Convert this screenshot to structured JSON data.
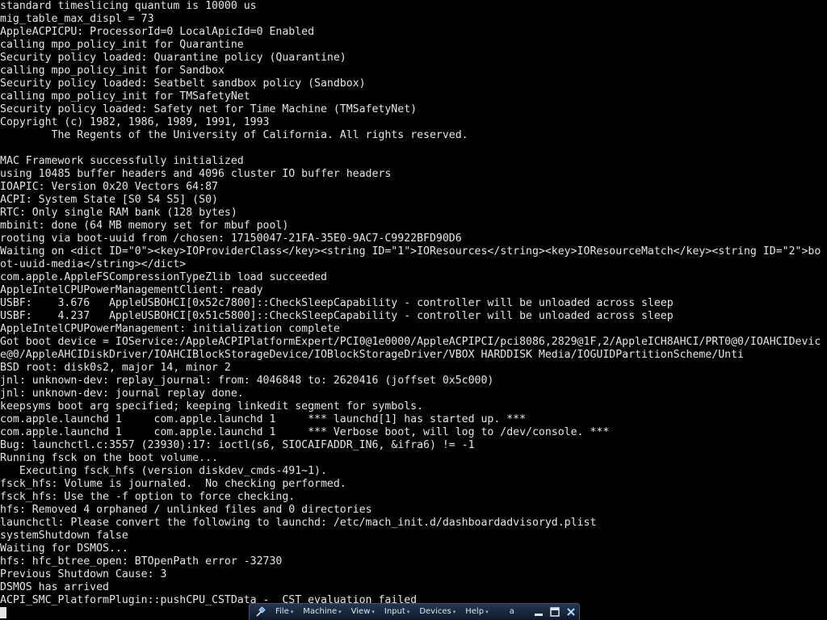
{
  "console": {
    "lines": [
      "standard timeslicing quantum is 10000 us",
      "mig_table_max_displ = 73",
      "AppleACPICPU: ProcessorId=0 LocalApicId=0 Enabled",
      "calling mpo_policy_init for Quarantine",
      "Security policy loaded: Quarantine policy (Quarantine)",
      "calling mpo_policy_init for Sandbox",
      "Security policy loaded: Seatbelt sandbox policy (Sandbox)",
      "calling mpo_policy_init for TMSafetyNet",
      "Security policy loaded: Safety net for Time Machine (TMSafetyNet)",
      "Copyright (c) 1982, 1986, 1989, 1991, 1993",
      "        The Regents of the University of California. All rights reserved.",
      "",
      "MAC Framework successfully initialized",
      "using 10485 buffer headers and 4096 cluster IO buffer headers",
      "IOAPIC: Version 0x20 Vectors 64:87",
      "ACPI: System State [S0 S4 S5] (S0)",
      "RTC: Only single RAM bank (128 bytes)",
      "mbinit: done (64 MB memory set for mbuf pool)",
      "rooting via boot-uuid from /chosen: 17150047-21FA-35E0-9AC7-C9922BFD90D6",
      "Waiting on <dict ID=\"0\"><key>IOProviderClass</key><string ID=\"1\">IOResources</string><key>IOResourceMatch</key><string ID=\"2\">bo",
      "ot-uuid-media</string></dict>",
      "com.apple.AppleFSCompressionTypeZlib load succeeded",
      "AppleIntelCPUPowerManagementClient: ready",
      "USBF:    3.676   AppleUSBOHCI[0x52c7800]::CheckSleepCapability - controller will be unloaded across sleep",
      "USBF:    4.237   AppleUSBOHCI[0x51c5800]::CheckSleepCapability - controller will be unloaded across sleep",
      "AppleIntelCPUPowerManagement: initialization complete",
      "Got boot device = IOService:/AppleACPIPlatformExpert/PCI0@1e0000/AppleACPIPCI/pci8086,2829@1F,2/AppleICH8AHCI/PRT0@0/IOAHCIDevic",
      "e@0/AppleAHCIDiskDriver/IOAHCIBlockStorageDevice/IOBlockStorageDriver/VBOX HARDDISK Media/IOGUIDPartitionScheme/Unti",
      "BSD root: disk0s2, major 14, minor 2",
      "jnl: unknown-dev: replay_journal: from: 4046848 to: 2620416 (joffset 0x5c000)",
      "jnl: unknown-dev: journal replay done.",
      "keepsyms boot arg specified; keeping linkedit segment for symbols.",
      "com.apple.launchd 1     com.apple.launchd 1     *** launchd[1] has started up. ***",
      "com.apple.launchd 1     com.apple.launchd 1     *** Verbose boot, will log to /dev/console. ***",
      "Bug: launchctl.c:3557 (23930):17: ioctl(s6, SIOCAIFADDR_IN6, &ifra6) != -1",
      "Running fsck on the boot volume...",
      "   Executing fsck_hfs (version diskdev_cmds-491~1).",
      "fsck_hfs: Volume is journaled.  No checking performed.",
      "fsck_hfs: Use the -f option to force checking.",
      "hfs: Removed 4 orphaned / unlinked files and 0 directories",
      "launchctl: Please convert the following to launchd: /etc/mach_init.d/dashboardadvisoryd.plist",
      "systemShutdown false",
      "Waiting for DSMOS...",
      "hfs: hfc_btree_open: BTOpenPath error -32730",
      "Previous Shutdown Cause: 3",
      "DSMOS has arrived",
      "ACPI_SMC_PlatformPlugin::pushCPU_CSTData - _CST evaluation failed"
    ]
  },
  "toolbar": {
    "menus": [
      "File",
      "Machine",
      "View",
      "Input",
      "Devices",
      "Help"
    ],
    "title": "a",
    "icons": [
      "pin-icon",
      "minimize-icon",
      "restore-icon",
      "close-icon"
    ],
    "colors": {
      "background": "#1b2a40",
      "text": "#dce6f5",
      "close": "#3a8ee6"
    }
  },
  "colors": {
    "console_background": "#000000",
    "console_text": "#e6e6e6"
  }
}
